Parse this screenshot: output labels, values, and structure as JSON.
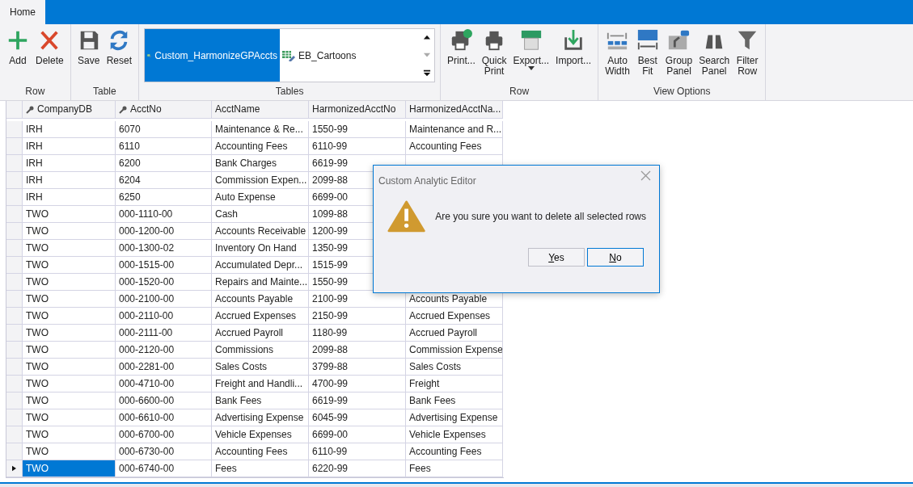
{
  "ribbon": {
    "tabs": [
      {
        "label": "Home",
        "selected": true
      }
    ],
    "groups": [
      {
        "label": "Row",
        "kind": "buttons",
        "items": [
          {
            "label": "Add"
          },
          {
            "label": "Delete"
          }
        ]
      },
      {
        "label": "Table",
        "kind": "buttons",
        "items": [
          {
            "label": "Save"
          },
          {
            "label": "Reset"
          }
        ]
      },
      {
        "label": "Tables",
        "kind": "gallery",
        "items": [
          {
            "label": "Custom_HarmonizeGPAccts",
            "selected": true
          },
          {
            "label": "EB_Cartoons",
            "selected": false
          }
        ]
      },
      {
        "label": "Row",
        "kind": "buttons",
        "items": [
          {
            "label": "Print..."
          },
          {
            "label": "Quick\nPrint"
          },
          {
            "label": "Export...",
            "dropdown": true
          },
          {
            "label": "Import..."
          }
        ]
      },
      {
        "label": "View Options",
        "kind": "buttons",
        "items": [
          {
            "label": "Auto\nWidth"
          },
          {
            "label": "Best\nFit"
          },
          {
            "label": "Group\nPanel"
          },
          {
            "label": "Search\nPanel"
          },
          {
            "label": "Filter\nRow"
          }
        ]
      }
    ]
  },
  "grid": {
    "columns": [
      {
        "label": "CompanyDB",
        "key": true
      },
      {
        "label": "AcctNo",
        "key": true
      },
      {
        "label": "AcctName",
        "key": false
      },
      {
        "label": "HarmonizedAcctNo",
        "key": false
      },
      {
        "label": "HarmonizedAcctNa...",
        "key": false
      }
    ],
    "rows": [
      {
        "cells": [
          "IRH",
          "6070",
          "Maintenance & Re...",
          "1550-99",
          "Maintenance and R..."
        ],
        "current": false,
        "selected": false
      },
      {
        "cells": [
          "IRH",
          "6110",
          "Accounting Fees",
          "6110-99",
          "Accounting Fees"
        ],
        "current": false,
        "selected": false
      },
      {
        "cells": [
          "IRH",
          "6200",
          "Bank Charges",
          "6619-99"
        ],
        "current": false,
        "selected": false
      },
      {
        "cells": [
          "IRH",
          "6204",
          "Commission Expen...",
          "2099-88"
        ],
        "current": false,
        "selected": false
      },
      {
        "cells": [
          "IRH",
          "6250",
          "Auto Expense",
          "6699-00"
        ],
        "current": false,
        "selected": false
      },
      {
        "cells": [
          "TWO",
          "000-1110-00",
          "Cash",
          "1099-88"
        ],
        "current": false,
        "selected": false
      },
      {
        "cells": [
          "TWO",
          "000-1200-00",
          "Accounts Receivable",
          "1200-99"
        ],
        "current": false,
        "selected": false
      },
      {
        "cells": [
          "TWO",
          "000-1300-02",
          "Inventory On Hand",
          "1350-99"
        ],
        "current": false,
        "selected": false
      },
      {
        "cells": [
          "TWO",
          "000-1515-00",
          "Accumulated Depr...",
          "1515-99"
        ],
        "current": false,
        "selected": false
      },
      {
        "cells": [
          "TWO",
          "000-1520-00",
          "Repairs and Mainte...",
          "1550-99"
        ],
        "current": false,
        "selected": false
      },
      {
        "cells": [
          "TWO",
          "000-2100-00",
          "Accounts Payable",
          "2100-99",
          "Accounts Payable"
        ],
        "current": false,
        "selected": false
      },
      {
        "cells": [
          "TWO",
          "000-2110-00",
          "Accrued Expenses",
          "2150-99",
          "Accrued Expenses"
        ],
        "current": false,
        "selected": false
      },
      {
        "cells": [
          "TWO",
          "000-2111-00",
          "Accrued Payroll",
          "1180-99",
          "Accrued Payroll"
        ],
        "current": false,
        "selected": false
      },
      {
        "cells": [
          "TWO",
          "000-2120-00",
          "Commissions",
          "2099-88",
          "Commission Expense"
        ],
        "current": false,
        "selected": false
      },
      {
        "cells": [
          "TWO",
          "000-2281-00",
          "Sales Costs",
          "3799-88",
          "Sales Costs"
        ],
        "current": false,
        "selected": false
      },
      {
        "cells": [
          "TWO",
          "000-4710-00",
          "Freight and Handli...",
          "4700-99",
          "Freight"
        ],
        "current": false,
        "selected": false
      },
      {
        "cells": [
          "TWO",
          "000-6600-00",
          "Bank Fees",
          "6619-99",
          "Bank Fees"
        ],
        "current": false,
        "selected": false
      },
      {
        "cells": [
          "TWO",
          "000-6610-00",
          "Advertising Expense",
          "6045-99",
          "Advertising Expense"
        ],
        "current": false,
        "selected": false
      },
      {
        "cells": [
          "TWO",
          "000-6700-00",
          "Vehicle Expenses",
          "6699-00",
          "Vehicle Expenses"
        ],
        "current": false,
        "selected": false
      },
      {
        "cells": [
          "TWO",
          "000-6730-00",
          "Accounting Fees",
          "6110-99",
          "Accounting Fees"
        ],
        "current": false,
        "selected": false
      },
      {
        "cells": [
          "TWO",
          "000-6740-00",
          "Fees",
          "6220-99",
          "Fees"
        ],
        "current": true,
        "selected": true
      }
    ]
  },
  "dialog": {
    "title": "Custom Analytic Editor",
    "message": "Are you sure you want to delete all selected rows",
    "buttons": [
      {
        "label": "Yes",
        "focused": false
      },
      {
        "label": "No",
        "focused": true
      }
    ]
  }
}
